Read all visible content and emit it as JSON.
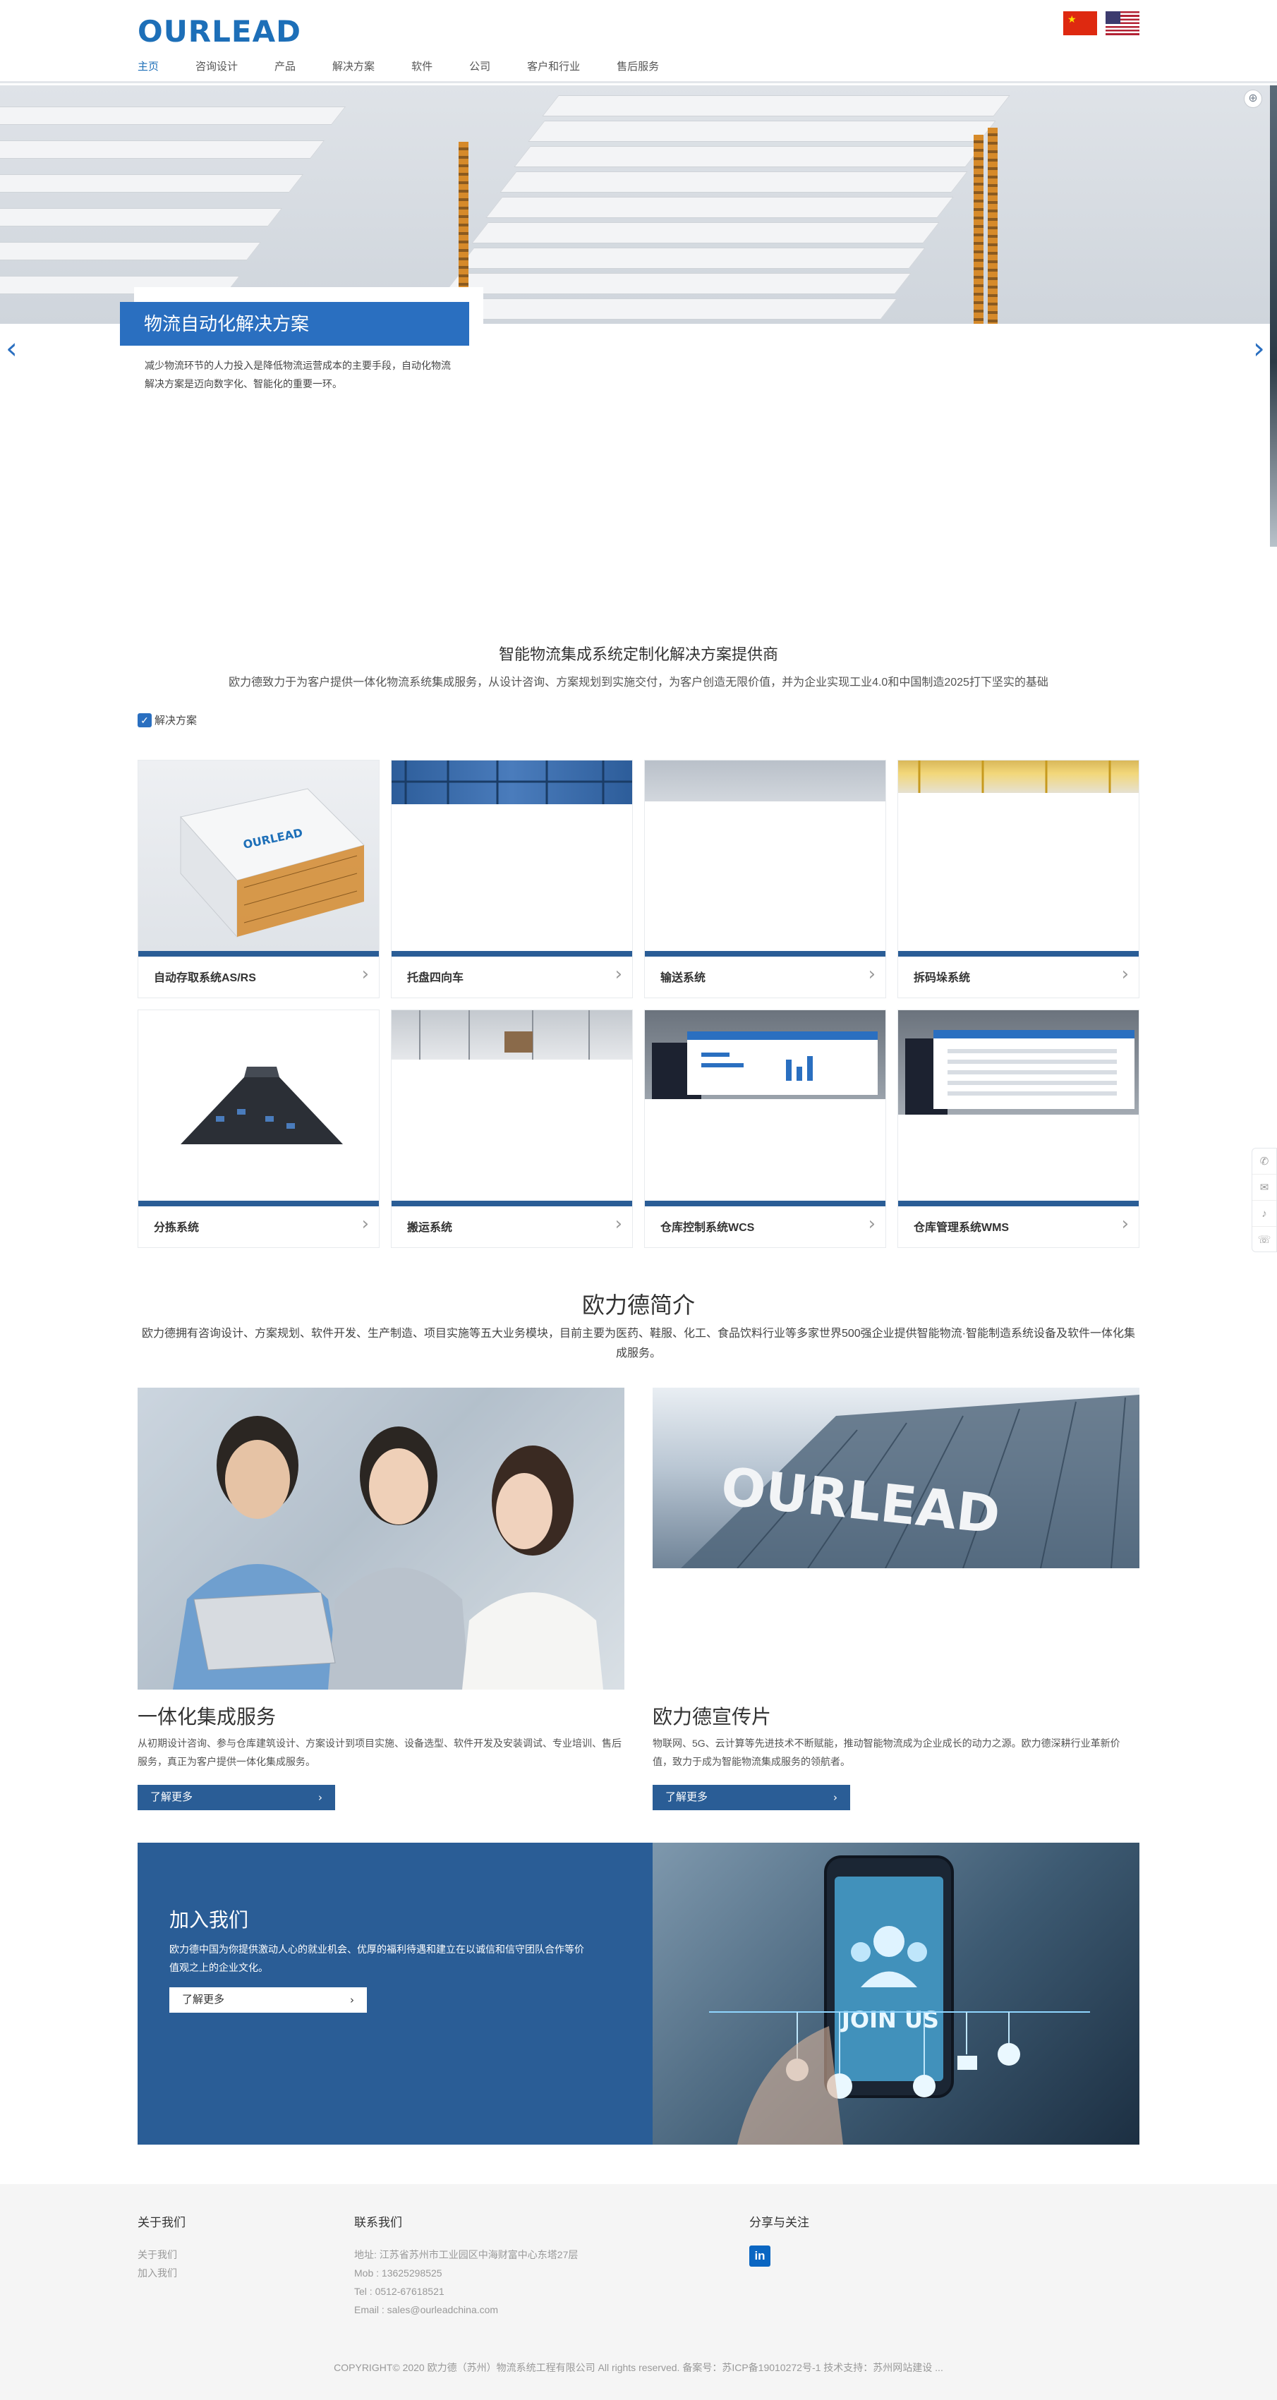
{
  "header": {
    "logo": "OURLEAD",
    "nav": [
      "主页",
      "咨询设计",
      "产品",
      "解决方案",
      "软件",
      "公司",
      "客户和行业",
      "售后服务"
    ],
    "active_nav": "主页"
  },
  "hero": {
    "title": "物流自动化解决方案",
    "desc": "减少物流环节的人力投入是降低物流运营成本的主要手段，自动化物流解决方案是迈向数字化、智能化的重要一环。",
    "prev": "‹",
    "next": "›"
  },
  "solutions": {
    "heading": "智能物流集成系统定制化解决方案提供商",
    "subheading": "欧力德致力于为客户提供一体化物流系统集成服务，从设计咨询、方案规划到实施交付，为客户创造无限价值，并为企业实现工业4.0和中国制造2025打下坚实的基础",
    "tab": "解决方案",
    "cards": [
      {
        "label": "自动存取系统AS/RS"
      },
      {
        "label": "托盘四向车"
      },
      {
        "label": "输送系统"
      },
      {
        "label": "拆码垛系统"
      },
      {
        "label": "分拣系统"
      },
      {
        "label": "搬运系统"
      },
      {
        "label": "仓库控制系统WCS"
      },
      {
        "label": "仓库管理系统WMS"
      }
    ]
  },
  "about": {
    "heading": "欧力德简介",
    "desc": "欧力德拥有咨询设计、方案规划、软件开发、生产制造、项目实施等五大业务模块，目前主要为医药、鞋服、化工、食品饮料行业等多家世界500强企业提供智能物流·智能制造系统设备及软件一体化集成服务。",
    "left": {
      "title": "一体化集成服务",
      "desc": "从初期设计咨询、参与仓库建筑设计、方案设计到项目实施、设备选型、软件开发及安装调试、专业培训、售后服务，真正为客户提供一体化集成服务。",
      "button": "了解更多"
    },
    "right": {
      "title": "欧力德宣传片",
      "desc": "物联网、5G、云计算等先进技术不断赋能，推动智能物流成为企业成长的动力之源。欧力德深耕行业革新价值，致力于成为智能物流集成服务的领航者。",
      "button": "了解更多",
      "sign": "OURLEAD"
    }
  },
  "join": {
    "title": "加入我们",
    "desc": "欧力德中国为你提供激动人心的就业机会、优厚的福利待遇和建立在以诚信和信守团队合作等价值观之上的企业文化。",
    "button": "了解更多",
    "image_text": "JOIN US"
  },
  "footer": {
    "about": {
      "heading": "关于我们",
      "links": [
        "关于我们",
        "加入我们"
      ]
    },
    "contact": {
      "heading": "联系我们",
      "lines": [
        "地址: 江苏省苏州市工业园区中海财富中心东塔27层",
        "Mob : 13625298525",
        "Tel : 0512-67618521",
        "Email : sales@ourleadchina.com"
      ]
    },
    "share": {
      "heading": "分享与关注",
      "linkedin": "in"
    },
    "copyright": "COPYRIGHT© 2020 欧力德（苏州）物流系统工程有限公司 All rights reserved. 备案号：苏ICP备19010272号-1 技术支持：苏州网站建设 ..."
  },
  "side_icons": [
    "phone-icon",
    "mail-icon",
    "bell-icon",
    "message-icon"
  ],
  "colors": {
    "brand": "#1d6fb8",
    "primary_dark": "#2a5d96",
    "footer_bg": "#f5f5f5"
  }
}
